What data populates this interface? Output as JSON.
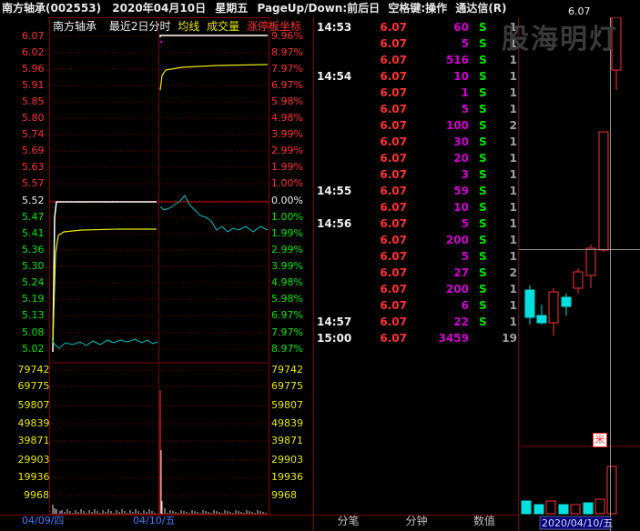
{
  "title": {
    "stock": "南方轴承(002553)",
    "date": "2020年04月10日",
    "weekday": "星期五",
    "hint": "PageUp/Down:前后日",
    "space_hint": "空格键:操作",
    "app": "通达信(R)"
  },
  "chart_header": {
    "name": "南方轴承",
    "mode": "最近2日分时",
    "avg_line": "均线",
    "volume": "成交量",
    "limit_label": "涨停板坐标"
  },
  "price_axis_left": [
    "6.07",
    "6.02",
    "5.96",
    "5.91",
    "5.85",
    "5.80",
    "5.74",
    "5.69",
    "5.63",
    "5.57",
    "5.52",
    "5.47",
    "5.41",
    "5.36",
    "5.30",
    "5.24",
    "5.19",
    "5.13",
    "5.08",
    "5.02"
  ],
  "price_axis_right": [
    "9.96%",
    "8.97%",
    "7.97%",
    "6.97%",
    "5.98%",
    "4.98%",
    "3.99%",
    "2.99%",
    "1.99%",
    "1.00%",
    "0.00%",
    "1.00%",
    "1.99%",
    "2.99%",
    "3.99%",
    "4.98%",
    "5.98%",
    "6.97%",
    "7.97%",
    "8.97%"
  ],
  "volume_axis": [
    "79742",
    "69775",
    "59807",
    "49839",
    "39871",
    "29903",
    "19936",
    "9968"
  ],
  "dates": {
    "day1": "04/09/四",
    "day2": "04/10/五"
  },
  "trades": [
    {
      "time": "14:53",
      "price": "6.07",
      "volume": "60",
      "side": "S",
      "count": "1"
    },
    {
      "time": "",
      "price": "6.07",
      "volume": "5",
      "side": "S",
      "count": "1"
    },
    {
      "time": "",
      "price": "6.07",
      "volume": "516",
      "side": "S",
      "count": "1"
    },
    {
      "time": "14:54",
      "price": "6.07",
      "volume": "10",
      "side": "S",
      "count": "1"
    },
    {
      "time": "",
      "price": "6.07",
      "volume": "1",
      "side": "S",
      "count": "1"
    },
    {
      "time": "",
      "price": "6.07",
      "volume": "5",
      "side": "S",
      "count": "1"
    },
    {
      "time": "",
      "price": "6.07",
      "volume": "100",
      "side": "S",
      "count": "2"
    },
    {
      "time": "",
      "price": "6.07",
      "volume": "30",
      "side": "S",
      "count": "1"
    },
    {
      "time": "",
      "price": "6.07",
      "volume": "20",
      "side": "S",
      "count": "1"
    },
    {
      "time": "",
      "price": "6.07",
      "volume": "3",
      "side": "S",
      "count": "1"
    },
    {
      "time": "14:55",
      "price": "6.07",
      "volume": "59",
      "side": "S",
      "count": "1"
    },
    {
      "time": "",
      "price": "6.07",
      "volume": "10",
      "side": "S",
      "count": "1"
    },
    {
      "time": "14:56",
      "price": "6.07",
      "volume": "5",
      "side": "S",
      "count": "1"
    },
    {
      "time": "",
      "price": "6.07",
      "volume": "200",
      "side": "S",
      "count": "1"
    },
    {
      "time": "",
      "price": "6.07",
      "volume": "5",
      "side": "S",
      "count": "1"
    },
    {
      "time": "",
      "price": "6.07",
      "volume": "27",
      "side": "S",
      "count": "2"
    },
    {
      "time": "",
      "price": "6.07",
      "volume": "200",
      "side": "S",
      "count": "1"
    },
    {
      "time": "",
      "price": "6.07",
      "volume": "6",
      "side": "S",
      "count": "1"
    },
    {
      "time": "14:57",
      "price": "6.07",
      "volume": "22",
      "side": "S",
      "count": "1"
    },
    {
      "time": "15:00",
      "price": "6.07",
      "volume": "3459",
      "side": "",
      "count": "19"
    }
  ],
  "tabs": {
    "tick": "分笔",
    "minute": "分钟",
    "data": "数值"
  },
  "kline": {
    "high_label": "6.07",
    "date_label": "2020/04/10/五",
    "marker": "米"
  },
  "watermark": "股海明灯",
  "colors": {
    "up": "#ff3232",
    "down": "#00e0e0",
    "avg": "#e8e800",
    "price_line": "#ffffff",
    "grid": "#800000"
  }
}
